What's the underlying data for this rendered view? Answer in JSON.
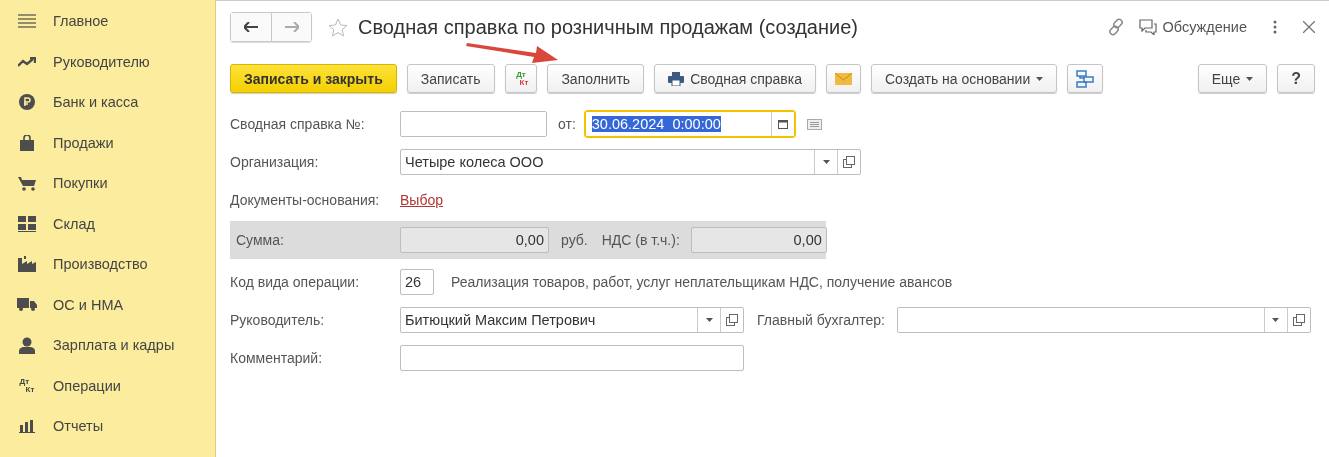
{
  "sidebar": {
    "items": [
      {
        "label": "Главное"
      },
      {
        "label": "Руководителю"
      },
      {
        "label": "Банк и касса"
      },
      {
        "label": "Продажи"
      },
      {
        "label": "Покупки"
      },
      {
        "label": "Склад"
      },
      {
        "label": "Производство"
      },
      {
        "label": "ОС и НМА"
      },
      {
        "label": "Зарплата и кадры"
      },
      {
        "label": "Операции",
        "icon_text": [
          "Дт",
          "Кт"
        ]
      },
      {
        "label": "Отчеты"
      }
    ]
  },
  "header": {
    "title": "Сводная справка по розничным продажам (создание)",
    "discussion": "Обсуждение"
  },
  "toolbar": {
    "buttons": [
      {
        "kind": "primary",
        "label": "Записать и закрыть"
      },
      {
        "kind": "plain",
        "label": "Записать"
      },
      {
        "kind": "dtkt",
        "icon_text": [
          "Дт",
          "Кт"
        ]
      },
      {
        "kind": "plain",
        "label": "Заполнить"
      },
      {
        "kind": "printer",
        "label": "Сводная справка"
      },
      {
        "kind": "envelope"
      },
      {
        "kind": "dropdown",
        "label": "Создать на основании"
      },
      {
        "kind": "structure"
      }
    ],
    "right_buttons": [
      {
        "kind": "dropdown",
        "label": "Еще"
      },
      {
        "kind": "help",
        "label": "?"
      }
    ]
  },
  "form": {
    "number": {
      "label": "Сводная справка №:"
    },
    "date": {
      "label": "от:",
      "value": "30.06.2024  0:00:00",
      "focused": true
    },
    "organization": {
      "label": "Организация:",
      "value": "Четыре колеса ООО"
    },
    "base_documents": {
      "label": "Документы-основания:",
      "link": "Выбор"
    },
    "totals": {
      "sum_label": "Сумма:",
      "sum_value": "0,00",
      "currency": "руб.",
      "vat_label": "НДС (в т.ч.):",
      "vat_value": "0,00"
    },
    "operation_code": {
      "label": "Код вида операции:",
      "value": "26",
      "description": "Реализация товаров, работ, услуг неплательщикам НДС, получение авансов"
    },
    "manager": {
      "label": "Руководитель:",
      "value": "Битюцкий Максим Петрович"
    },
    "chief_accountant": {
      "label": "Главный бухгалтер:"
    },
    "comment": {
      "label": "Комментарий:"
    }
  }
}
